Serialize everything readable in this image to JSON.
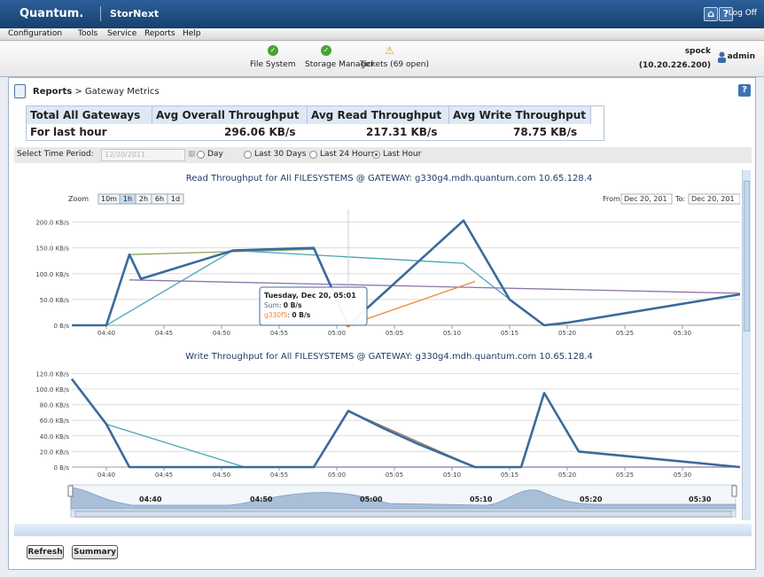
{
  "header": {
    "brand": "Quantum.",
    "product": "StorNext",
    "logoff": "Log Off"
  },
  "menu": [
    "Configuration",
    "Tools",
    "Service",
    "Reports",
    "Help"
  ],
  "status": [
    {
      "label": "File System",
      "icon": "ok-check-icon"
    },
    {
      "label": "Storage Manager",
      "icon": "ok-check-icon"
    },
    {
      "label": "Tickets (69 open)",
      "icon": "warning-icon"
    }
  ],
  "user": {
    "host": "spock",
    "ip": "(10.20.226.200)",
    "role": "admin"
  },
  "breadcrumb": {
    "section": "Reports",
    "page": " > Gateway Metrics"
  },
  "summary": {
    "headers": [
      "Total All Gateways",
      "Avg Overall Throughput",
      "Avg Read Throughput",
      "Avg Write Throughput"
    ],
    "row_label": "For last hour",
    "values": [
      "296.06 KB/s",
      "217.31 KB/s",
      "78.75 KB/s"
    ]
  },
  "period": {
    "label": "Select Time Period:",
    "date_placeholder": "12/20/2011",
    "options": [
      "Day",
      "Last 30 Days",
      "Last 24 Hours",
      "Last Hour"
    ],
    "selected": "Last Hour"
  },
  "zoom": {
    "label": "Zoom",
    "buttons": [
      "10m",
      "1h",
      "2h",
      "6h",
      "1d"
    ],
    "selected": "1h"
  },
  "range": {
    "from_label": "From:",
    "from": "Dec 20, 201",
    "to_label": "To:",
    "to": "Dec 20, 201"
  },
  "tooltip": {
    "title": "Tuesday, Dec 20, 05:01",
    "sum_label": "Sum",
    "sum_value": "0 B/s",
    "g_label": "g330f5",
    "g_value": "0 B/s"
  },
  "buttons": {
    "refresh": "Refresh",
    "summary": "Summary"
  },
  "colors": {
    "sum": "#3b6a9c",
    "teal": "#4aa5b8",
    "green": "#8ca85a",
    "purple": "#8e74a8",
    "orange": "#e98a3a",
    "brown": "#a07a5c"
  },
  "chart_data": [
    {
      "type": "line",
      "title": "Read Throughput for All FILESYSTEMS @ GATEWAY: g330g4.mdh.quantum.com 10.65.128.4",
      "x_ticks": [
        "04:40",
        "04:45",
        "04:50",
        "04:55",
        "05:00",
        "05:05",
        "05:10",
        "05:15",
        "05:20",
        "05:25",
        "05:30"
      ],
      "y_ticks": [
        "0 B/s",
        "50.0 KB/s",
        "100.0 KB/s",
        "150.0 KB/s",
        "200.0 KB/s"
      ],
      "ylim": [
        0,
        225
      ],
      "series": [
        {
          "name": "Sum",
          "color": "#3b6a9c",
          "points": [
            [
              "04:37",
              0
            ],
            [
              "04:40",
              0
            ],
            [
              "04:42",
              137
            ],
            [
              "04:43",
              90
            ],
            [
              "04:51",
              145
            ],
            [
              "04:58",
              150
            ],
            [
              "05:01",
              0
            ],
            [
              "05:11",
              203
            ],
            [
              "05:15",
              50
            ],
            [
              "05:18",
              0
            ],
            [
              "05:20",
              5
            ],
            [
              "05:35",
              60
            ]
          ]
        },
        {
          "color": "#4aa5b8",
          "points": [
            [
              "04:40",
              0
            ],
            [
              "04:51",
              145
            ],
            [
              "05:11",
              120
            ],
            [
              "05:15",
              50
            ]
          ]
        },
        {
          "color": "#8ca85a",
          "points": [
            [
              "04:42",
              137
            ],
            [
              "04:58",
              147
            ]
          ]
        },
        {
          "color": "#8e74a8",
          "points": [
            [
              "04:42",
              88
            ],
            [
              "05:35",
              62
            ]
          ]
        },
        {
          "name": "g330f5",
          "color": "#e98a3a",
          "points": [
            [
              "05:01",
              0
            ],
            [
              "05:12",
              85
            ]
          ]
        }
      ]
    },
    {
      "type": "line",
      "title": "Write Throughput for All FILESYSTEMS @ GATEWAY: g330g4.mdh.quantum.com 10.65.128.4",
      "x_ticks": [
        "04:40",
        "04:45",
        "04:50",
        "04:55",
        "05:00",
        "05:05",
        "05:10",
        "05:15",
        "05:20",
        "05:25",
        "05:30"
      ],
      "y_ticks": [
        "0 B/s",
        "20.0 KB/s",
        "40.0 KB/s",
        "60.0 KB/s",
        "80.0 KB/s",
        "100.0 KB/s",
        "120.0 KB/s"
      ],
      "ylim": [
        0,
        125
      ],
      "series": [
        {
          "color": "#3b6a9c",
          "points": [
            [
              "04:37",
              113
            ],
            [
              "04:40",
              55
            ],
            [
              "04:42",
              0
            ],
            [
              "04:52",
              0
            ],
            [
              "04:58",
              0
            ],
            [
              "05:01",
              72
            ],
            [
              "05:04",
              50
            ],
            [
              "05:07",
              30
            ],
            [
              "05:12",
              0
            ],
            [
              "05:16",
              0
            ],
            [
              "05:18",
              95
            ],
            [
              "05:21",
              20
            ],
            [
              "05:35",
              0
            ]
          ]
        },
        {
          "color": "#4aa5b8",
          "points": [
            [
              "04:40",
              55
            ],
            [
              "04:52",
              0
            ]
          ]
        },
        {
          "color": "#a07a5c",
          "points": [
            [
              "05:01",
              72
            ],
            [
              "05:12",
              0
            ]
          ]
        },
        {
          "color": "#8e74a8",
          "points": [
            [
              "04:42",
              0
            ],
            [
              "05:35",
              0
            ]
          ]
        }
      ]
    }
  ],
  "navigator": {
    "labels": [
      "04:40",
      "04:50",
      "05:00",
      "05:10",
      "05:20",
      "05:30"
    ]
  }
}
